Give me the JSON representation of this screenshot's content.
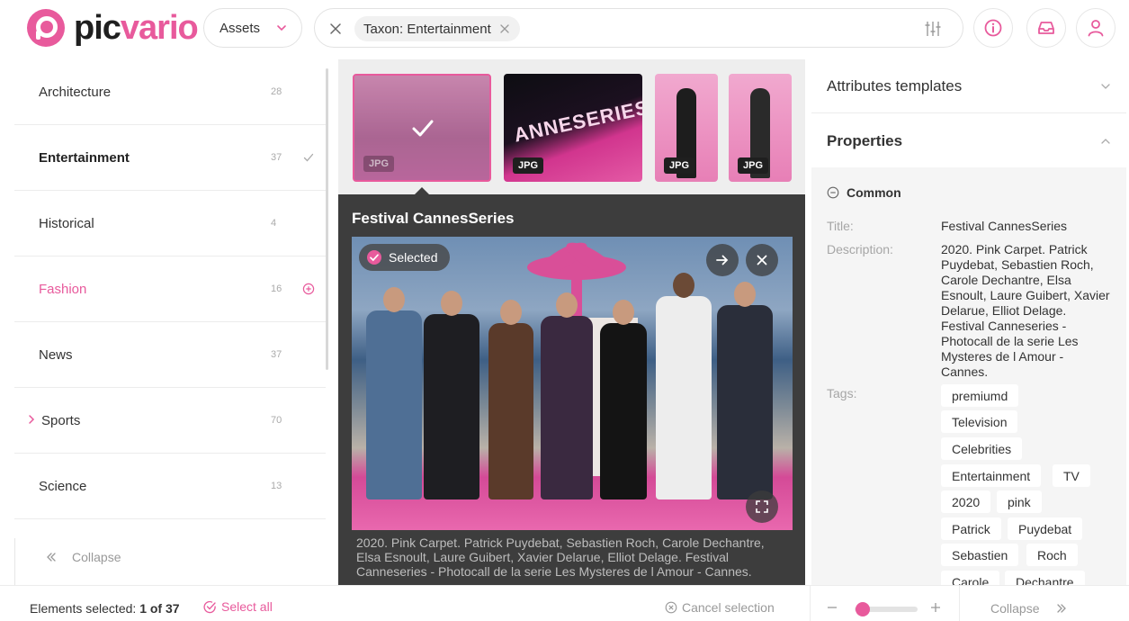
{
  "header": {
    "logo_pic": "pic",
    "logo_vario": "vario",
    "assets_label": "Assets",
    "filter_chip": "Taxon: Entertainment"
  },
  "sidebar": {
    "items": [
      {
        "name": "Architecture",
        "count": "28"
      },
      {
        "name": "Entertainment",
        "count": "37"
      },
      {
        "name": "Historical",
        "count": "4"
      },
      {
        "name": "Fashion",
        "count": "16"
      },
      {
        "name": "News",
        "count": "37"
      },
      {
        "name": "Sports",
        "count": "70"
      },
      {
        "name": "Science",
        "count": "13"
      }
    ],
    "collapse_label": "Collapse"
  },
  "center": {
    "thumbs": [
      {
        "badge": "JPG"
      },
      {
        "badge": "JPG",
        "text": "ANNESERIES"
      },
      {
        "badge": "JPG"
      },
      {
        "badge": "JPG"
      }
    ],
    "preview_title": "Festival CannesSeries",
    "selected_label": "Selected",
    "caption": "2020. Pink Carpet. Patrick Puydebat, Sebastien Roch, Carole Dechantre, Elsa Esnoult, Laure Guibert, Xavier Delarue, Elliot Delage. Festival Canneseries - Photocall de la serie Les Mysteres de l Amour - Cannes."
  },
  "right": {
    "attributes_templates": "Attributes templates",
    "properties": "Properties",
    "common": "Common",
    "title_label": "Title:",
    "title_value": "Festival CannesSeries",
    "description_label": "Description:",
    "description_value": "2020. Pink Carpet. Patrick Puydebat, Sebastien Roch, Carole Dechantre, Elsa Esnoult, Laure Guibert, Xavier Delarue, Elliot Delage. Festival Canneseries - Photocall de la serie Les Mysteres de l Amour - Cannes.",
    "tags_label": "Tags:",
    "tags": [
      "premiumd",
      "Television",
      "Celebrities",
      "Entertainment",
      "TV",
      "2020",
      "pink",
      "Patrick",
      "Puydebat",
      "Sebastien",
      "Roch",
      "Carole",
      "Dechantre"
    ]
  },
  "footer": {
    "selected_prefix": "Elements selected:",
    "selected_count": "1 of 37",
    "select_all": "Select all",
    "cancel_selection": "Cancel selection",
    "collapse": "Collapse",
    "zoom_level": 0.05
  },
  "colors": {
    "accent": "#e85a9c",
    "dark_panel": "#3d3d3d"
  }
}
